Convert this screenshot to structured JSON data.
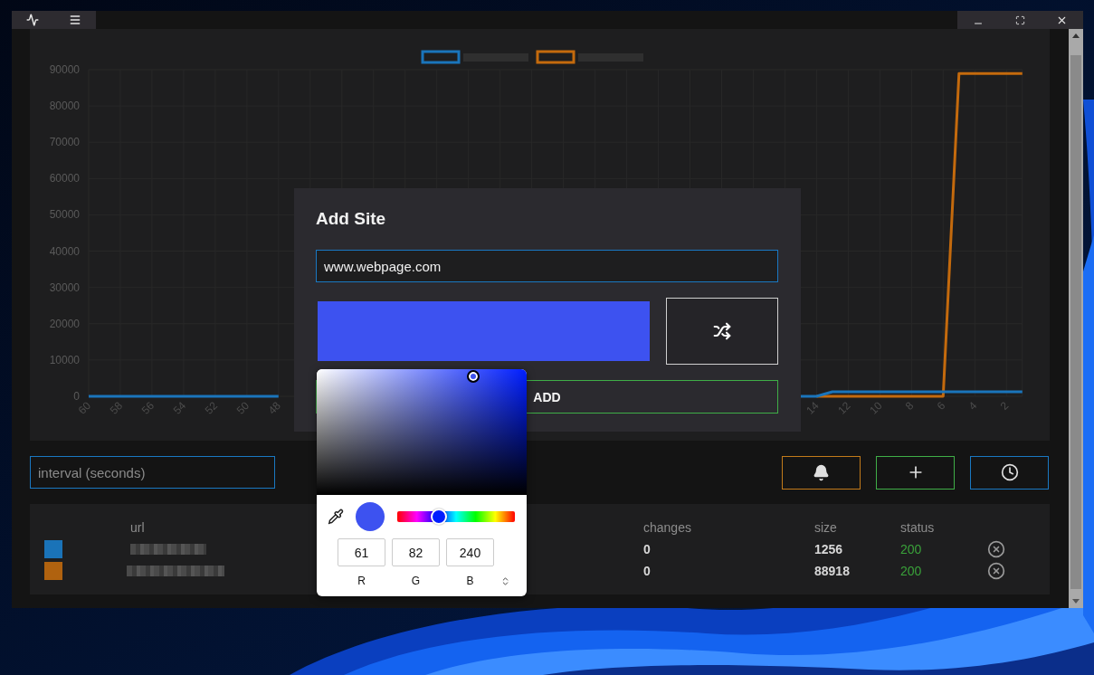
{
  "chart": {
    "chart_data": {
      "type": "line",
      "grid": true,
      "x": [
        60,
        59,
        58,
        57,
        56,
        55,
        54,
        53,
        52,
        51,
        50,
        49,
        48,
        47,
        46,
        45,
        44,
        43,
        42,
        41,
        40,
        39,
        38,
        37,
        36,
        35,
        34,
        33,
        32,
        31,
        30,
        29,
        28,
        27,
        26,
        25,
        24,
        23,
        22,
        21,
        20,
        19,
        18,
        17,
        16,
        15,
        14,
        13,
        12,
        11,
        10,
        9,
        8,
        7,
        6,
        5,
        4,
        3,
        2,
        1
      ],
      "series": [
        {
          "color": "#1a75bb",
          "values": [
            0,
            0,
            0,
            0,
            0,
            0,
            0,
            0,
            0,
            0,
            0,
            0,
            0,
            null,
            null,
            null,
            null,
            null,
            null,
            null,
            null,
            null,
            null,
            null,
            null,
            null,
            null,
            null,
            null,
            null,
            null,
            null,
            null,
            null,
            null,
            null,
            null,
            null,
            null,
            null,
            null,
            null,
            null,
            null,
            null,
            0,
            0,
            1256,
            1256,
            1256,
            1256,
            1256,
            1256,
            1256,
            1256,
            1256,
            1256,
            1256,
            1256,
            1256
          ]
        },
        {
          "color": "#c46a0d",
          "values": [
            null,
            null,
            null,
            null,
            null,
            null,
            null,
            null,
            null,
            null,
            null,
            null,
            null,
            null,
            null,
            null,
            null,
            null,
            null,
            null,
            null,
            null,
            null,
            null,
            null,
            null,
            null,
            null,
            null,
            null,
            null,
            null,
            null,
            null,
            null,
            null,
            null,
            null,
            null,
            null,
            null,
            null,
            null,
            null,
            null,
            null,
            0,
            0,
            0,
            0,
            0,
            0,
            0,
            0,
            0,
            88918,
            88918,
            88918,
            88918,
            88918
          ]
        }
      ],
      "xlim": [
        60,
        1
      ],
      "xticks": [
        60,
        58,
        56,
        54,
        52,
        50,
        48,
        14,
        12,
        10,
        8,
        6,
        4,
        2
      ],
      "yticks": [
        0,
        10000,
        20000,
        30000,
        40000,
        50000,
        60000,
        70000,
        80000,
        90000
      ],
      "ylim": [
        0,
        90000
      ]
    }
  },
  "dialog": {
    "title": "Add Site",
    "url_field": {
      "value": "www.webpage.com"
    },
    "color_swatch": {
      "color": "#3d52f0"
    },
    "add_button": "ADD",
    "color_picker": {
      "hue_slider": {
        "level": 0.35
      },
      "channels": [
        {
          "value": "61",
          "label": "R"
        },
        {
          "value": "82",
          "label": "G"
        },
        {
          "value": "240",
          "label": "B"
        }
      ]
    }
  },
  "interval_field": {
    "placeholder": "interval (seconds)"
  },
  "sites": {
    "columns": [
      "url",
      "changes",
      "size",
      "status"
    ],
    "rows": [
      {
        "color": "#1a73b8",
        "changes": "0",
        "size": "1256",
        "status": "200"
      },
      {
        "color": "#b0620f",
        "changes": "0",
        "size": "88918",
        "status": "200"
      }
    ]
  }
}
